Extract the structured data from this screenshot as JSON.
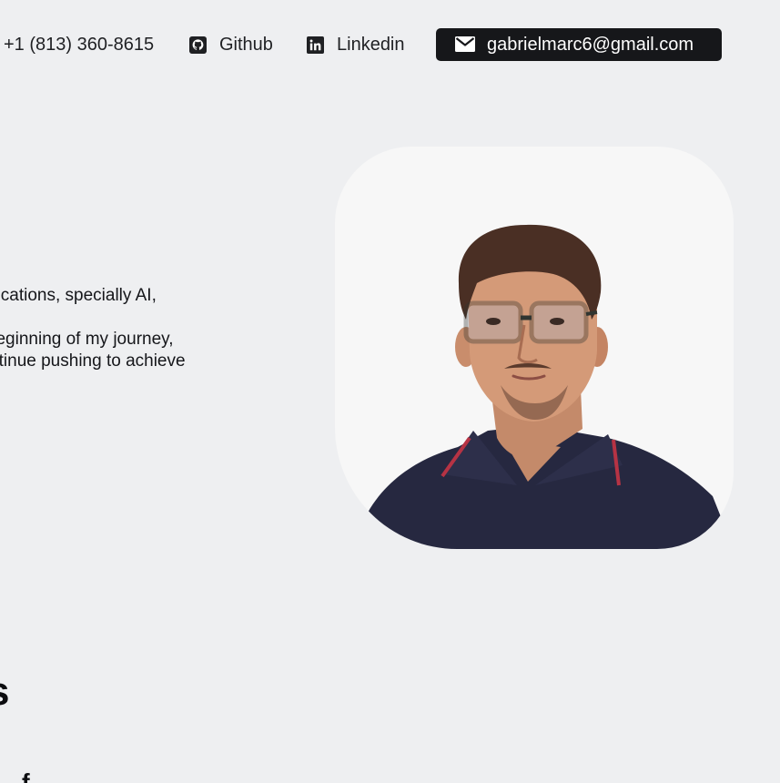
{
  "contact": {
    "phone": "+1 (813) 360-8615",
    "github_label": "Github",
    "linkedin_label": "Linkedin",
    "email": "gabrielmarc6@gmail.com"
  },
  "icons": {
    "github": "github-icon",
    "linkedin": "linkedin-icon",
    "email": "mail-icon"
  },
  "bio": {
    "line1": "cations, specially AI,",
    "line2": "he beginning of my journey,",
    "line3": "ontinue pushing to achieve"
  },
  "section": {
    "heading_fragment": "s",
    "subheading_fragment": "f"
  },
  "colors": {
    "background": "#eeeff1",
    "email_button": "#16171a",
    "photo_card": "#f7f7f7",
    "text": "#1f2023"
  }
}
